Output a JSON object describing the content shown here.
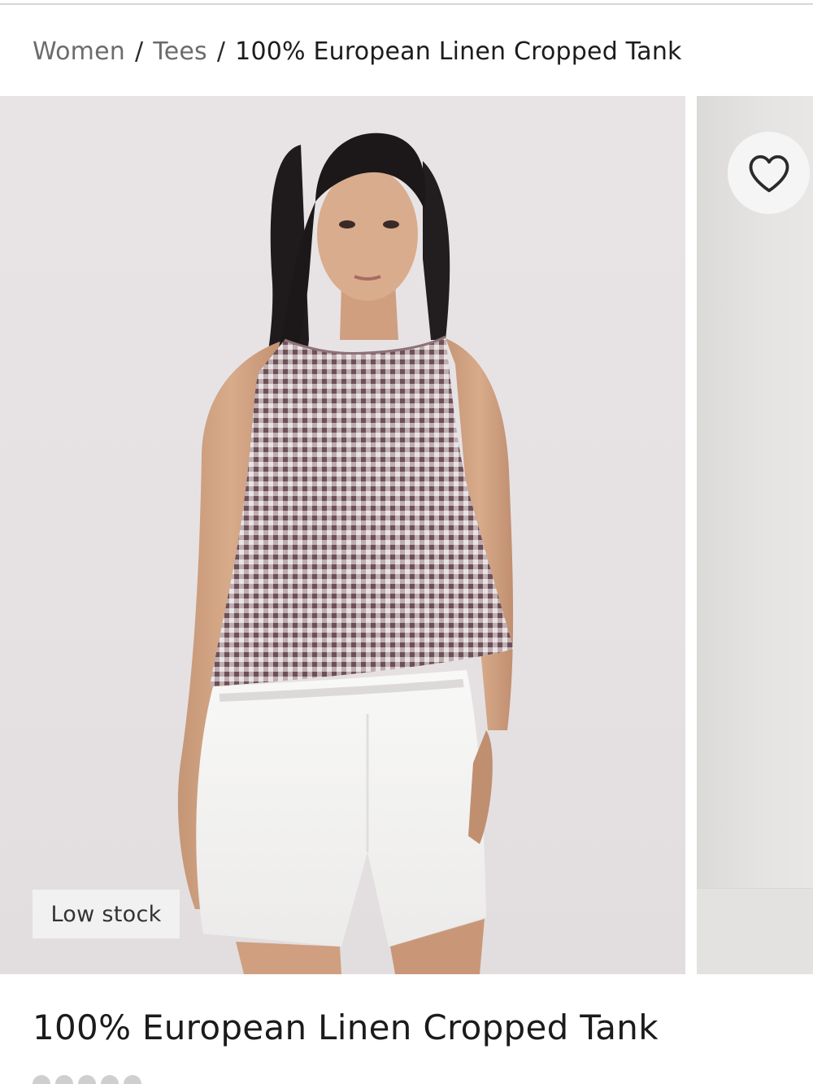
{
  "breadcrumb": {
    "items": [
      {
        "label": "Women"
      },
      {
        "label": "Tees"
      },
      {
        "label": "100% European Linen Cropped Tank"
      }
    ],
    "separator": "/"
  },
  "gallery": {
    "badge": "Low stock",
    "favorite_icon": "heart-outline-icon"
  },
  "product": {
    "title": "100% European Linen Cropped Tank"
  }
}
